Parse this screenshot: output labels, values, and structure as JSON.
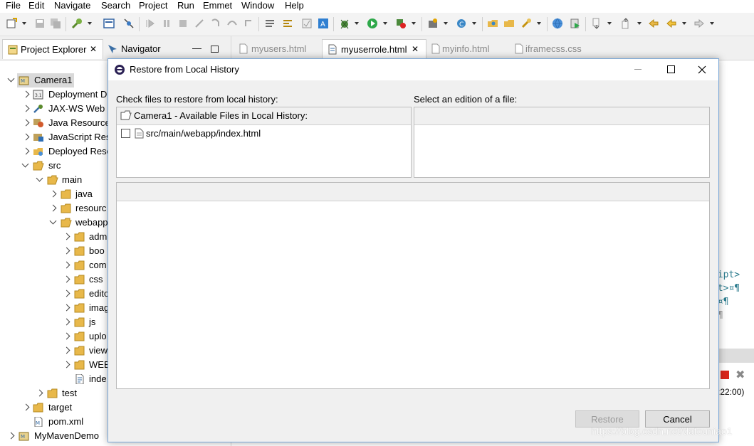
{
  "menu": [
    "File",
    "Edit",
    "Navigate",
    "Search",
    "Project",
    "Run",
    "Emmet",
    "Window",
    "Help"
  ],
  "views": {
    "project_explorer": "Project Explorer",
    "navigator": "Navigator"
  },
  "tree": [
    {
      "label": "Camera1",
      "icon": "project-icon"
    },
    {
      "label": "Deployment D",
      "icon": "deployment-icon"
    },
    {
      "label": "JAX-WS Web S",
      "icon": "webservice-icon"
    },
    {
      "label": "Java Resource",
      "icon": "java-resources-icon"
    },
    {
      "label": "JavaScript Res",
      "icon": "javascript-icon"
    },
    {
      "label": "Deployed Reso",
      "icon": "deployed-icon"
    },
    {
      "label": "src",
      "icon": "folder-icon"
    },
    {
      "label": "main",
      "icon": "folder-icon"
    },
    {
      "label": "java",
      "icon": "folder-icon"
    },
    {
      "label": "resourc",
      "icon": "folder-icon"
    },
    {
      "label": "webapp",
      "icon": "folder-icon"
    },
    {
      "label": "adm",
      "icon": "folder-icon"
    },
    {
      "label": "boo",
      "icon": "folder-icon"
    },
    {
      "label": "com",
      "icon": "folder-icon"
    },
    {
      "label": "css",
      "icon": "folder-icon"
    },
    {
      "label": "edito",
      "icon": "folder-icon"
    },
    {
      "label": "imag",
      "icon": "folder-icon"
    },
    {
      "label": "js",
      "icon": "folder-icon"
    },
    {
      "label": "uplo",
      "icon": "folder-icon"
    },
    {
      "label": "view",
      "icon": "folder-icon"
    },
    {
      "label": "WEB",
      "icon": "folder-icon"
    },
    {
      "label": "inde",
      "icon": "html-file-icon"
    },
    {
      "label": "test",
      "icon": "folder-icon"
    },
    {
      "label": "target",
      "icon": "folder-icon"
    },
    {
      "label": "pom.xml",
      "icon": "maven-file-icon"
    },
    {
      "label": "MyMavenDemo",
      "icon": "project-icon"
    }
  ],
  "editor_tabs": [
    "myusers.html",
    "myuserrole.html",
    "myinfo.html",
    "iframecss.css"
  ],
  "code_lines": [
    "ript>",
    "pt>¤¶",
    ">¤¶",
    "¤¶"
  ],
  "console_time": ":22:00)",
  "dialog": {
    "title": "Restore from Local History",
    "left_label": "Check files to restore from local history:",
    "right_label": "Select an edition of a file:",
    "tree_header": "Camera1 - Available Files in Local History:",
    "file_item": "src/main/webapp/index.html",
    "restore_label": "Restore",
    "cancel_label": "Cancel"
  },
  "watermark": "https://blog.csdn.net/datouniao1",
  "colors": {
    "folder": "#e8b84a",
    "selection": "#d9d9d9",
    "dialog_border": "#7aa7d8"
  }
}
